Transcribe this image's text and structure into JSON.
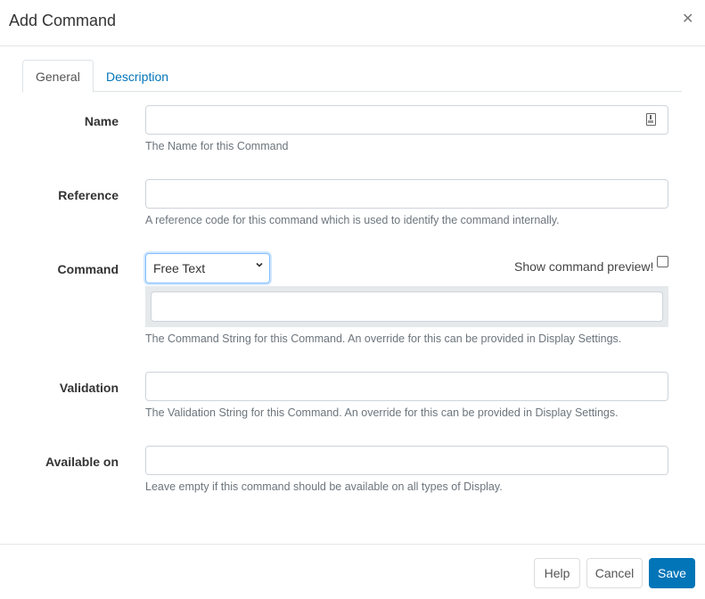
{
  "dialog": {
    "title": "Add Command",
    "close_icon": "close-icon"
  },
  "tabs": [
    {
      "label": "General",
      "active": true
    },
    {
      "label": "Description",
      "active": false
    }
  ],
  "form": {
    "name": {
      "label": "Name",
      "value": "",
      "help": "The Name for this Command",
      "icon": "password-manager-icon"
    },
    "reference": {
      "label": "Reference",
      "value": "",
      "help": "A reference code for this command which is used to identify the command internally."
    },
    "command": {
      "label": "Command",
      "type_selected": "Free Text",
      "preview_label": "Show command preview!",
      "preview_checked": false,
      "value": "",
      "help": "The Command String for this Command. An override for this can be provided in Display Settings."
    },
    "validation": {
      "label": "Validation",
      "value": "",
      "help": "The Validation String for this Command. An override for this can be provided in Display Settings."
    },
    "available_on": {
      "label": "Available on",
      "value": "",
      "help": "Leave empty if this command should be available on all types of Display."
    }
  },
  "footer": {
    "help_label": "Help",
    "cancel_label": "Cancel",
    "save_label": "Save"
  },
  "colors": {
    "primary": "#0275b8",
    "tab_link": "#0275b8",
    "muted_text": "#6c757d"
  }
}
